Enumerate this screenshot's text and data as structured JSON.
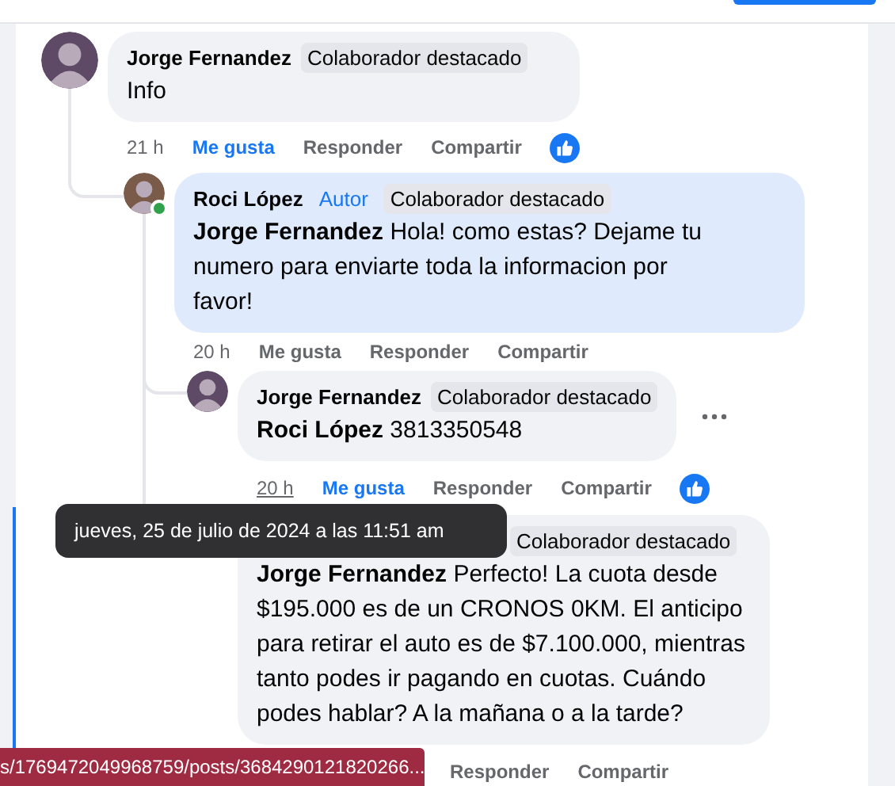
{
  "comments": [
    {
      "author": "Jorge Fernandez",
      "online": false,
      "highlighted": false,
      "more_menu": false,
      "badges": [
        {
          "text": "Colaborador destacado",
          "kind": "featured"
        }
      ],
      "text": "Info",
      "actions": [
        {
          "kind": "time",
          "text": "21 h",
          "underlined": false
        },
        {
          "kind": "like",
          "text": "Me gusta",
          "liked": true
        },
        {
          "kind": "reply",
          "text": "Responder"
        },
        {
          "kind": "share",
          "text": "Compartir"
        }
      ],
      "reaction": true,
      "children": [
        {
          "author": "Roci López",
          "online": true,
          "highlighted": true,
          "more_menu": false,
          "badges": [
            {
              "text": "Autor",
              "kind": "author"
            },
            {
              "text": "Colaborador destacado",
              "kind": "featured"
            }
          ],
          "text": "**Jorge Fernandez** Hola! como estas? Dejame tu numero para enviarte toda la informacion por favor!",
          "actions": [
            {
              "kind": "time",
              "text": "20 h",
              "underlined": false
            },
            {
              "kind": "like",
              "text": "Me gusta",
              "liked": false
            },
            {
              "kind": "reply",
              "text": "Responder"
            },
            {
              "kind": "share",
              "text": "Compartir"
            }
          ],
          "reaction": false,
          "children": [
            {
              "author": "Jorge Fernandez",
              "online": false,
              "highlighted": false,
              "more_menu": true,
              "badges": [
                {
                  "text": "Colaborador destacado",
                  "kind": "featured"
                }
              ],
              "text": "**Roci López** 3813350548",
              "actions": [
                {
                  "kind": "time",
                  "text": "20 h",
                  "underlined": true
                },
                {
                  "kind": "like",
                  "text": "Me gusta",
                  "liked": true
                },
                {
                  "kind": "reply",
                  "text": "Responder"
                },
                {
                  "kind": "share",
                  "text": "Compartir"
                }
              ],
              "reaction": true
            },
            {
              "highlighted": false,
              "more_menu": false,
              "badges": [
                {
                  "text": "Colaborador destacado",
                  "kind": "featured"
                }
              ],
              "text": "**Jorge Fernandez** Perfecto! La cuota desde $195.000 es de un CRONOS 0KM. El anticipo para retirar el auto es de $7.100.000, mientras tanto podes ir pagando en cuotas. Cuándo podes hablar? A la mañana o a la tarde?",
              "actions": [
                {
                  "kind": "reply",
                  "text": "Responder"
                },
                {
                  "kind": "share",
                  "text": "Compartir"
                }
              ],
              "reaction": false
            }
          ]
        }
      ]
    }
  ],
  "tooltip": "jueves, 25 de julio de 2024 a las 11:51 am",
  "status_bar": "s/1769472049968759/posts/3684290121820266..."
}
